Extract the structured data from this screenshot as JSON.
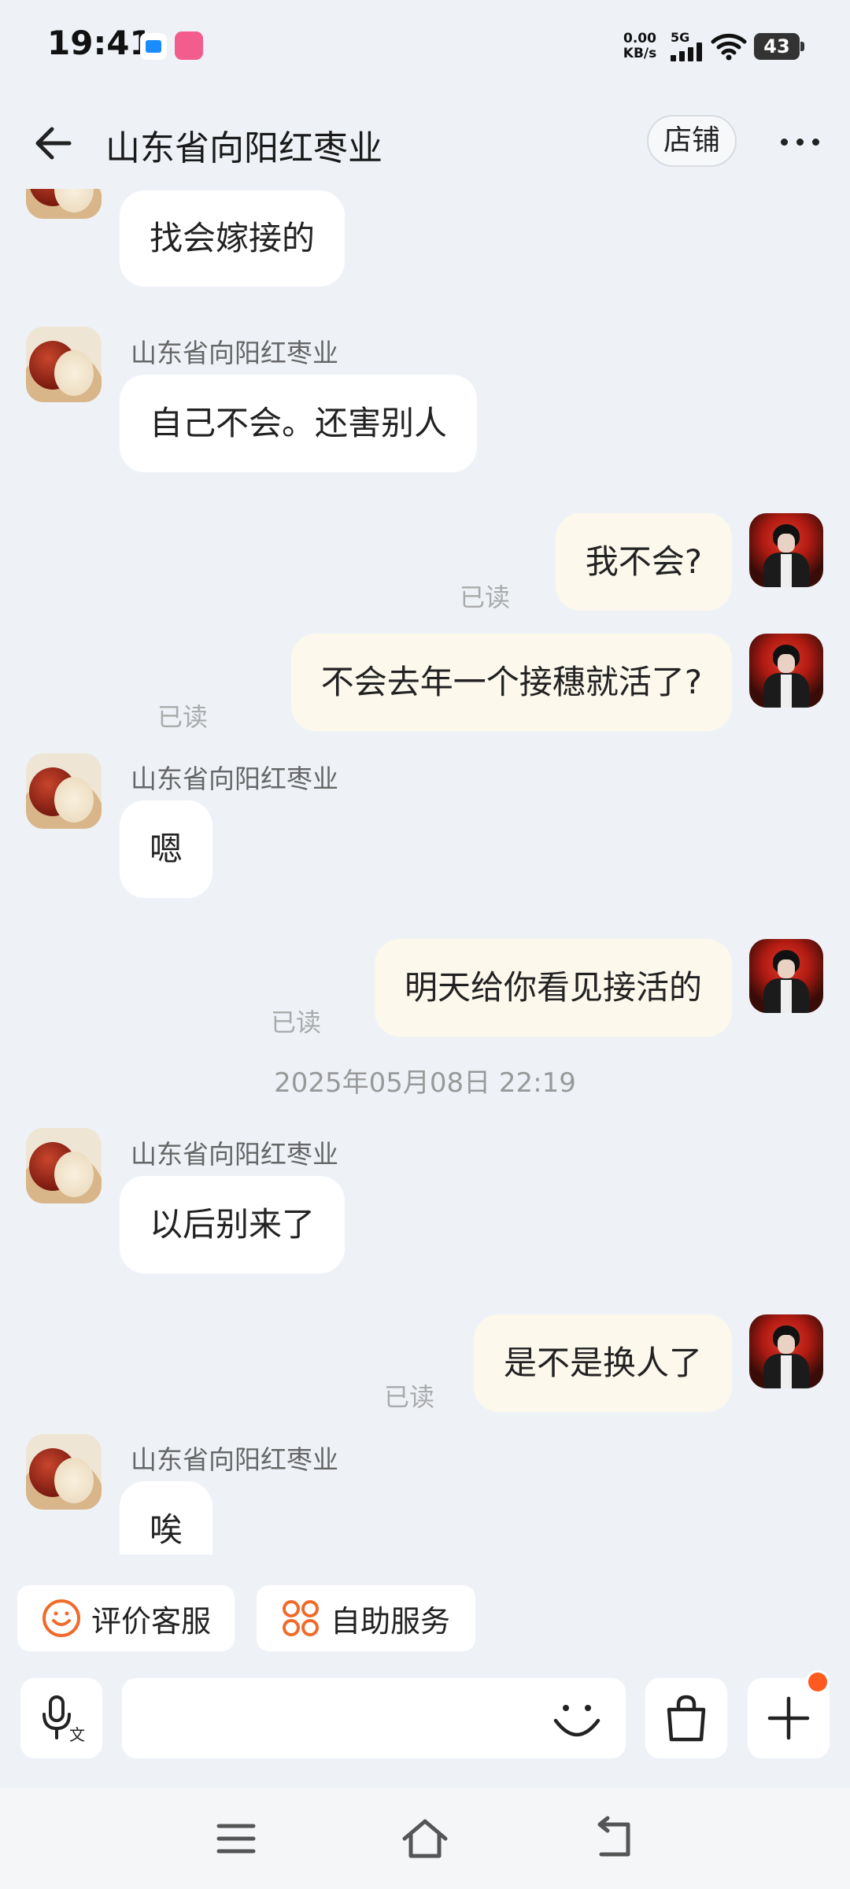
{
  "status_bar": {
    "time": "19:41",
    "net_speed_value": "0.00",
    "net_speed_unit": "KB/s",
    "network_type": "5G",
    "battery": "43",
    "icons": [
      "app-notification-icon",
      "bilibili-icon",
      "signal-icon",
      "wifi-icon",
      "battery-icon"
    ]
  },
  "header": {
    "title": "山东省向阳红枣业",
    "store_label": "店铺",
    "back_icon": "back-arrow-icon",
    "more_icon": "more-icon"
  },
  "messages": [
    {
      "side": "left",
      "name": "",
      "text": "找会嫁接的"
    },
    {
      "side": "left",
      "name": "山东省向阳红枣业",
      "text": "自己不会。还害别人"
    },
    {
      "side": "right",
      "text": "我不会?",
      "read": "已读"
    },
    {
      "side": "right",
      "text": "不会去年一个接穗就活了?",
      "read": "已读"
    },
    {
      "side": "left",
      "name": "山东省向阳红枣业",
      "text": "嗯"
    },
    {
      "side": "right",
      "text": "明天给你看见接活的",
      "read": "已读"
    },
    {
      "timestamp": "2025年05月08日 22:19"
    },
    {
      "side": "left",
      "name": "山东省向阳红枣业",
      "text": "以后别来了"
    },
    {
      "side": "right",
      "text": "是不是换人了",
      "read": "已读"
    },
    {
      "side": "left",
      "name": "山东省向阳红枣业",
      "text": "唉"
    }
  ],
  "quick_actions": {
    "evaluate_label": "评价客服",
    "self_service_label": "自助服务"
  },
  "input_bar": {
    "placeholder": "",
    "icons": [
      "voice-input-icon",
      "emoji-icon",
      "shopping-bag-icon",
      "plus-icon"
    ]
  },
  "nav_bar": {
    "icons": [
      "menu-icon",
      "home-icon",
      "back-icon"
    ]
  },
  "colors": {
    "background": "#eef2f7",
    "incoming_bubble": "#ffffff",
    "outgoing_bubble": "#fcf8ec",
    "accent_orange": "#f06a2a",
    "badge_dot": "#ff5a1f"
  }
}
